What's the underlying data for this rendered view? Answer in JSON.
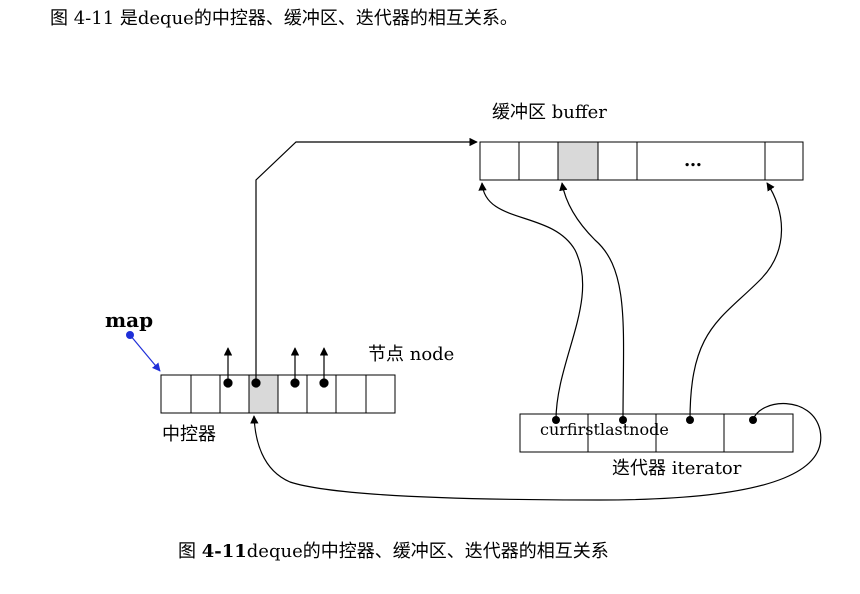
{
  "top_caption": "图  4-11    是deque的中控器、缓冲区、迭代器的相互关系。",
  "bottom_caption": {
    "prefix": "图  ",
    "number": "4-11",
    "text": "deque的中控器、缓冲区、迭代器的相互关系"
  },
  "labels": {
    "map": "map",
    "node": "节点  node",
    "buffer": "缓冲区  buffer",
    "map_control": "中控器",
    "iterator": "迭代器  iterator",
    "iterator_fields": "curfirstlastnode",
    "ellipsis": "…"
  },
  "colors": {
    "stroke": "#000000",
    "highlight": "#d9d9d9",
    "map_pointer": "#1f2fd8"
  }
}
